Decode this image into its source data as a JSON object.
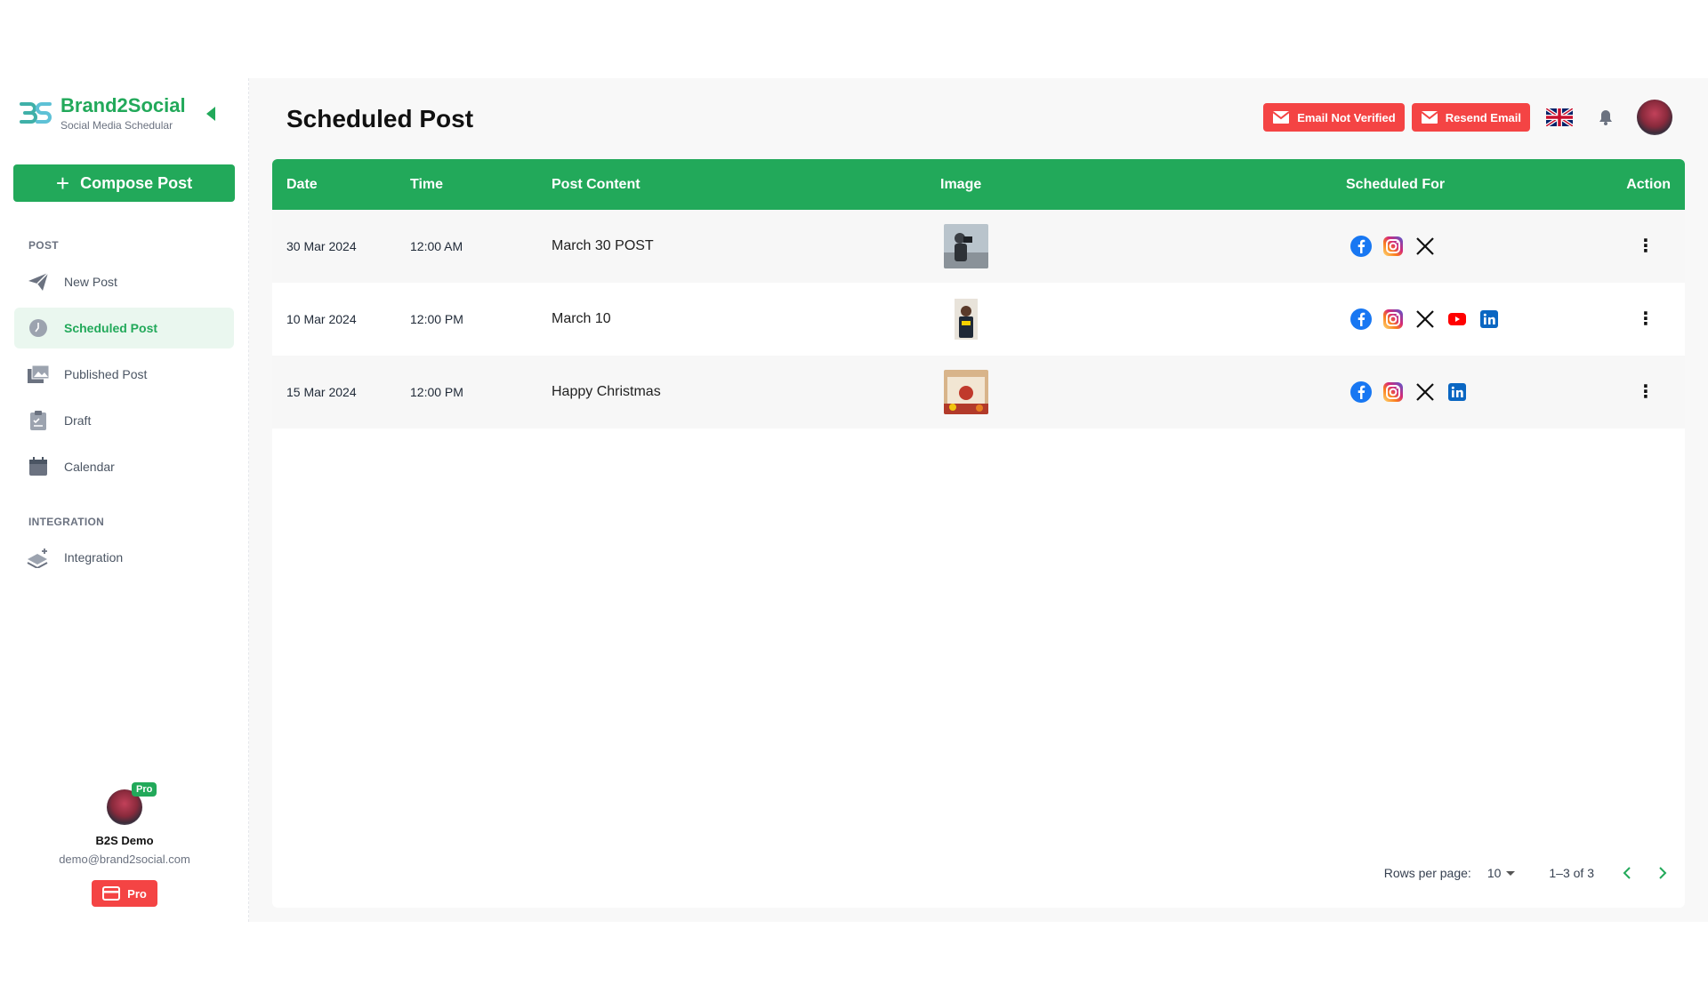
{
  "brand": {
    "name": "Brand2Social",
    "subtitle": "Social Media Schedular"
  },
  "compose": {
    "label": "Compose Post"
  },
  "sidebar": {
    "post_section": "POST",
    "items": [
      {
        "label": "New Post",
        "icon": "paper-plane-icon"
      },
      {
        "label": "Scheduled Post",
        "icon": "clock-icon"
      },
      {
        "label": "Published Post",
        "icon": "gallery-icon"
      },
      {
        "label": "Draft",
        "icon": "clipboard-icon"
      },
      {
        "label": "Calendar",
        "icon": "calendar-icon"
      }
    ],
    "integration_section": "INTEGRATION",
    "integration_items": [
      {
        "label": "Integration",
        "icon": "layers-icon"
      }
    ]
  },
  "profile": {
    "badge": "Pro",
    "name": "B2S Demo",
    "email": "demo@brand2social.com",
    "plan_button": "Pro"
  },
  "header": {
    "title": "Scheduled Post",
    "email_not_verified": "Email Not Verified",
    "resend_email": "Resend Email"
  },
  "table": {
    "headers": {
      "date": "Date",
      "time": "Time",
      "content": "Post Content",
      "image": "Image",
      "scheduled_for": "Scheduled For",
      "action": "Action"
    },
    "rows": [
      {
        "date": "30 Mar 2024",
        "time": "12:00 AM",
        "content": "March 30 POST",
        "image": "photographer-thumbnail",
        "platforms": [
          "facebook",
          "instagram",
          "x"
        ]
      },
      {
        "date": "10 Mar 2024",
        "time": "12:00 PM",
        "content": "March 10",
        "image": "person-thumbnail",
        "platforms": [
          "facebook",
          "instagram",
          "x",
          "youtube",
          "linkedin"
        ]
      },
      {
        "date": "15 Mar 2024",
        "time": "12:00 PM",
        "content": "Happy Christmas",
        "image": "christmas-thumbnail",
        "platforms": [
          "facebook",
          "instagram",
          "x",
          "linkedin"
        ]
      }
    ]
  },
  "pagination": {
    "rows_per_page_label": "Rows per page:",
    "rows_per_page": "10",
    "range": "1–3 of 3"
  },
  "colors": {
    "brand_green": "#22a95a",
    "danger_red": "#f44444",
    "facebook": "#1877f2",
    "linkedin": "#0a66c2",
    "youtube": "#ff0000"
  }
}
